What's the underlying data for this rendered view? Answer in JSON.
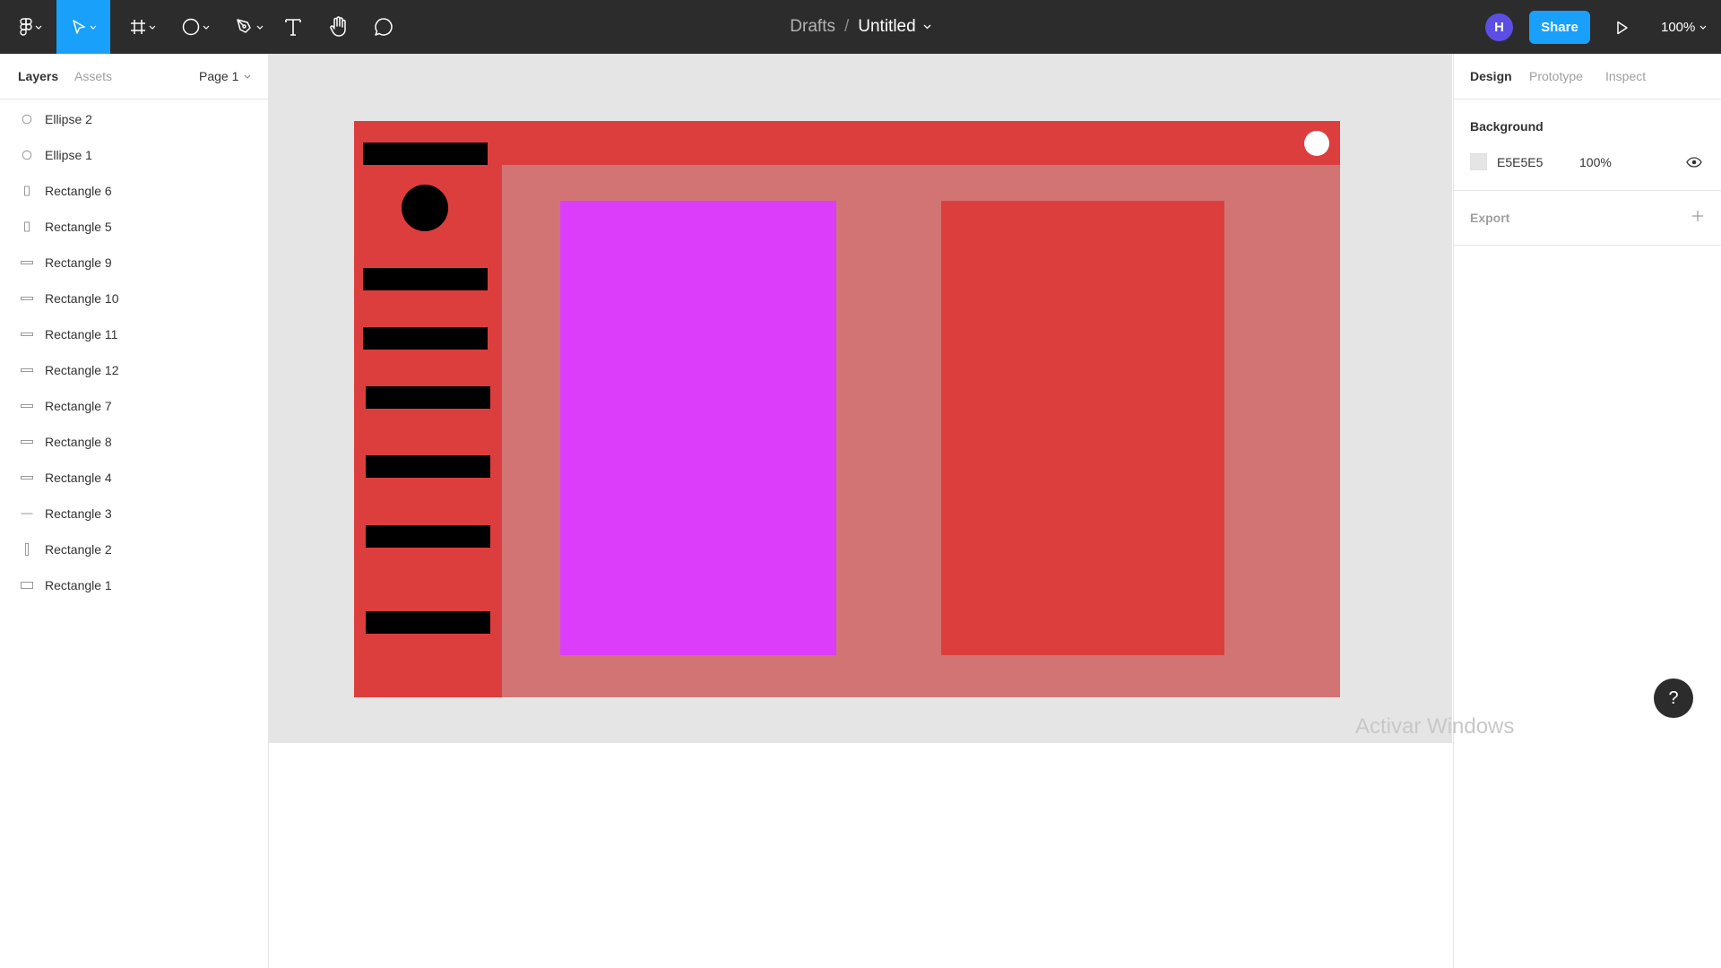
{
  "toolbar": {
    "tools": [
      "main-menu",
      "move",
      "frame",
      "shape",
      "pen",
      "text",
      "hand",
      "comment"
    ],
    "breadcrumb": "Drafts",
    "separator": "/",
    "file_name": "Untitled",
    "avatar_initial": "H",
    "share_label": "Share",
    "zoom": "100%",
    "accent_color": "#18a0fb",
    "avatar_color": "#5c4ee5"
  },
  "left_panel": {
    "tabs": [
      "Layers",
      "Assets"
    ],
    "page": "Page 1",
    "layers": [
      {
        "label": "Ellipse 2",
        "icon": "ellipse-icon"
      },
      {
        "label": "Ellipse 1",
        "icon": "ellipse-icon"
      },
      {
        "label": "Rectangle 6",
        "icon": "rectangle-vertical-icon"
      },
      {
        "label": "Rectangle 5",
        "icon": "rectangle-vertical-icon"
      },
      {
        "label": "Rectangle 9",
        "icon": "rectangle-bar-icon"
      },
      {
        "label": "Rectangle 10",
        "icon": "rectangle-bar-icon"
      },
      {
        "label": "Rectangle 11",
        "icon": "rectangle-bar-icon"
      },
      {
        "label": "Rectangle 12",
        "icon": "rectangle-bar-icon"
      },
      {
        "label": "Rectangle 7",
        "icon": "rectangle-bar-icon"
      },
      {
        "label": "Rectangle 8",
        "icon": "rectangle-bar-icon"
      },
      {
        "label": "Rectangle 4",
        "icon": "rectangle-bar-icon"
      },
      {
        "label": "Rectangle 3",
        "icon": "rectangle-line-icon"
      },
      {
        "label": "Rectangle 2",
        "icon": "rectangle-thin-vertical-icon"
      },
      {
        "label": "Rectangle 1",
        "icon": "rectangle-horizontal-icon"
      }
    ]
  },
  "canvas": {
    "background": "#e5e5e5",
    "frame_color": "#dc3e3e",
    "content_color": "#d27474",
    "card_magenta": "#dc3dfb",
    "card_red": "#dc3e3e"
  },
  "right_panel": {
    "tabs": [
      "Design",
      "Prototype",
      "Inspect"
    ],
    "background_title": "Background",
    "background_hex": "E5E5E5",
    "background_opacity": "100%",
    "export_title": "Export"
  },
  "help_label": "?",
  "watermark": "Activar Windows"
}
